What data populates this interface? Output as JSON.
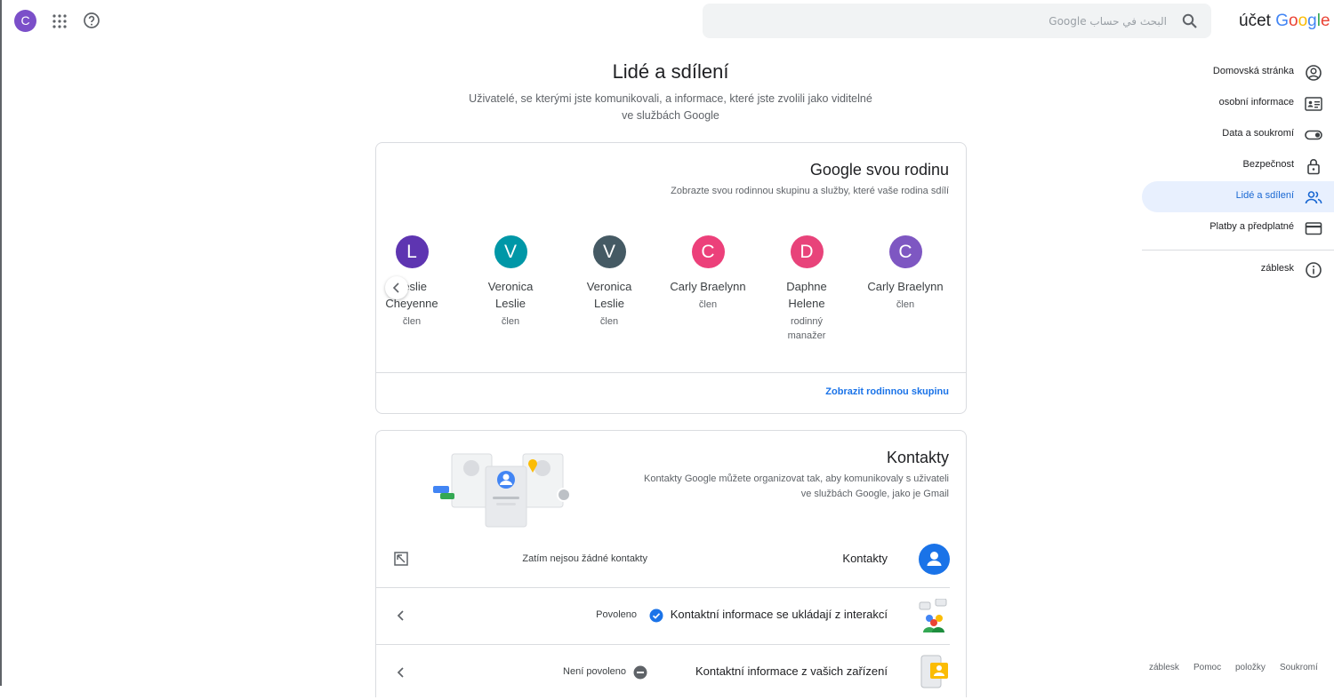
{
  "topbar": {
    "avatar_letter": "C",
    "search_placeholder": "البحث في حساب Google",
    "brand_account": "účet",
    "brand_google": [
      "G",
      "o",
      "o",
      "g",
      "l",
      "e"
    ]
  },
  "page": {
    "title": "Lidé a sdílení",
    "subtitle_line1": "Uživatelé, se kterými jste komunikovali, a informace, které jste zvolili jako viditelné",
    "subtitle_line2": "ve službách Google"
  },
  "family": {
    "title": "Google svou rodinu",
    "description": "Zobrazte svou rodinnou skupinu a služby, které vaše rodina sdílí",
    "members": [
      {
        "letter": "L",
        "name1": "Leslie",
        "name2": "Cheyenne",
        "role1": "člen",
        "role2": "",
        "color": "#5e35b1"
      },
      {
        "letter": "V",
        "name1": "Veronica",
        "name2": "Leslie",
        "role1": "člen",
        "role2": "",
        "color": "#0097a7"
      },
      {
        "letter": "V",
        "name1": "Veronica",
        "name2": "Leslie",
        "role1": "člen",
        "role2": "",
        "color": "#455a64"
      },
      {
        "letter": "C",
        "name1": "Carly Braelynn",
        "name2": "",
        "role1": "člen",
        "role2": "",
        "color": "#ec407a"
      },
      {
        "letter": "D",
        "name1": "Daphne",
        "name2": "Helene",
        "role1": "rodinný",
        "role2": "manažer",
        "color": "#e8437a"
      },
      {
        "letter": "C",
        "name1": "Carly Braelynn",
        "name2": "",
        "role1": "člen",
        "role2": "",
        "color": "#7e57c2"
      }
    ],
    "link": "Zobrazit rodinnou skupinu"
  },
  "contacts": {
    "title": "Kontakty",
    "description_line1": "Kontakty Google můžete organizovat tak, aby komunikovaly s uživateli",
    "description_line2": "ve službách Google, jako je Gmail",
    "rows": [
      {
        "label": "Kontakty",
        "status": "Zatím nejsou žádné kontakty"
      },
      {
        "label": "Kontaktní informace se ukládají z interakcí",
        "status": "Povoleno"
      },
      {
        "label": "Kontaktní informace z vašich zařízení",
        "status": "Není povoleno"
      }
    ]
  },
  "sidebar": {
    "items": [
      {
        "label": "Domovská stránka",
        "icon": "account-circle-icon"
      },
      {
        "label": "osobní informace",
        "icon": "id-card-icon"
      },
      {
        "label": "Data a soukromí",
        "icon": "toggle-icon"
      },
      {
        "label": "Bezpečnost",
        "icon": "lock-icon"
      },
      {
        "label": "Lidé a sdílení",
        "icon": "people-icon",
        "active": true
      },
      {
        "label": "Platby a předplatné",
        "icon": "credit-card-icon"
      }
    ],
    "about": {
      "label": "záblesk",
      "icon": "info-icon"
    }
  },
  "footer": {
    "links": [
      "záblesk",
      "Pomoc",
      "položky",
      "Soukromí"
    ]
  },
  "colors": {
    "accent": "#1a73e8",
    "active_bg": "#e8f0fe",
    "google_letters": [
      "#4285f4",
      "#ea4335",
      "#fbbc05",
      "#4285f4",
      "#34a853",
      "#ea4335"
    ]
  }
}
